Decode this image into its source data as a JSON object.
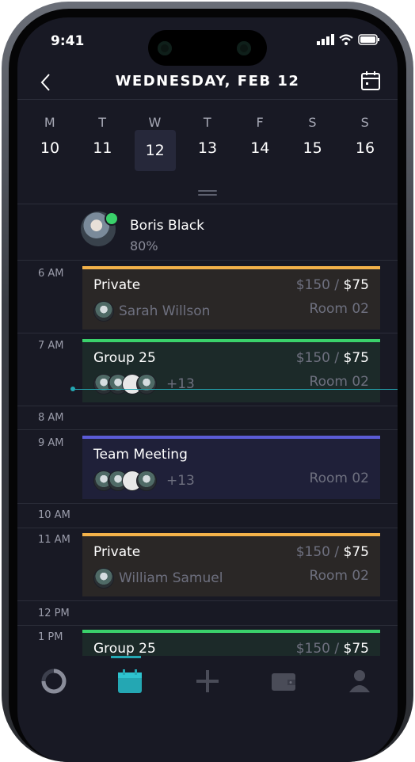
{
  "status": {
    "time": "9:41"
  },
  "header": {
    "title": "WEDNESDAY, FEB 12"
  },
  "week": [
    {
      "letter": "M",
      "num": "10"
    },
    {
      "letter": "T",
      "num": "11"
    },
    {
      "letter": "W",
      "num": "12",
      "selected": true
    },
    {
      "letter": "T",
      "num": "13"
    },
    {
      "letter": "F",
      "num": "14"
    },
    {
      "letter": "S",
      "num": "15"
    },
    {
      "letter": "S",
      "num": "16"
    }
  ],
  "profile": {
    "name": "Boris Black",
    "percent": "80%"
  },
  "times": [
    "6 AM",
    "7 AM",
    "8 AM",
    "9 AM",
    "10 AM",
    "11 AM",
    "12 PM",
    "1 PM"
  ],
  "events": [
    {
      "title": "Private",
      "price_old": "$150",
      "sep": " / ",
      "price": "$75",
      "person": "Sarah Willson",
      "room": "Room 02",
      "color": "#f3b24a"
    },
    {
      "title": "Group 25",
      "price_old": "$150",
      "sep": " / ",
      "price": "$75",
      "more": "+13",
      "room": "Room 02",
      "color": "#3ad16b"
    },
    {
      "title": "Team Meeting",
      "more": "+13",
      "room": "Room 02",
      "color": "#5b5bd6"
    },
    {
      "title": "Private",
      "price_old": "$150",
      "sep": " / ",
      "price": "$75",
      "person": "William Samuel",
      "room": "Room 02",
      "color": "#f3b24a"
    },
    {
      "title": "Group 25",
      "price_old": "$150",
      "sep": " / ",
      "price": "$75",
      "color": "#3ad16b"
    }
  ],
  "tabs": [
    "activity-icon",
    "calendar-icon",
    "add-icon",
    "wallet-icon",
    "profile-icon"
  ],
  "colors": {
    "accent": "#24a7b3"
  }
}
